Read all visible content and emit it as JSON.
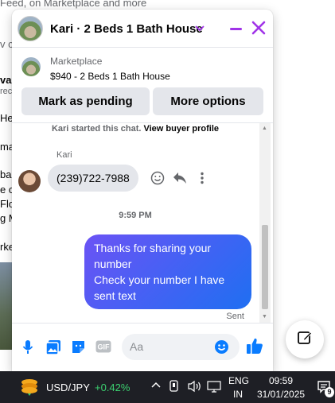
{
  "background": {
    "top_text": "Feed, on Marketplace and more",
    "frag_1": "v c",
    "frag_2": "va",
    "frag_3": "rec",
    "frag_4": "He",
    "frag_5": "ma",
    "frag_6": "bas",
    "frag_7": "e o",
    "frag_8": "Flo",
    "frag_9": "g M",
    "frag_10": "rke"
  },
  "header": {
    "title": "Kari · 2 Beds 1 Bath House"
  },
  "marketplace": {
    "label": "Marketplace",
    "listing": "$940 - 2 Beds 1 Bath House",
    "mark_pending": "Mark as pending",
    "more_options": "More options"
  },
  "conversation": {
    "system_started": "Kari started this chat.",
    "system_link": "View buyer profile",
    "sender_name": "Kari",
    "incoming_message": "(239)722-7988",
    "timestamp": "9:59 PM",
    "outgoing_lines": [
      "Thanks for sharing your",
      "number",
      "Check your number I have",
      "sent text"
    ],
    "status": "Sent"
  },
  "composer": {
    "placeholder": "Aa",
    "gif_label": "GIF"
  },
  "taskbar": {
    "ticker": "USD/JPY",
    "change": "+0.42%",
    "lang_top": "ENG",
    "lang_bottom": "IN",
    "time": "09:59",
    "date": "31/01/2025",
    "notification_count": "9"
  },
  "colors": {
    "accent": "#a033e8",
    "bubble_start": "#6b53f5",
    "bubble_end": "#1f6ff2",
    "composer_icon": "#0a7cff",
    "ticker_positive": "#3cd070"
  }
}
